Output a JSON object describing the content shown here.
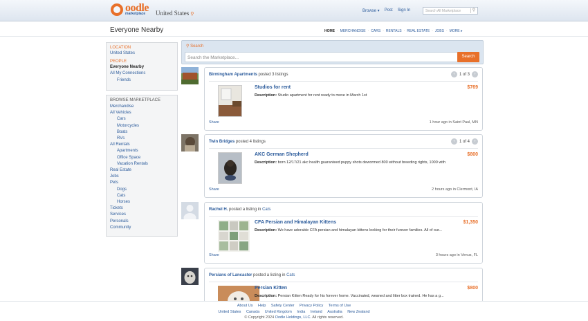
{
  "header": {
    "logo_main": "oodle",
    "logo_sub": "marketplace",
    "country": "United States",
    "nav": [
      "Browse ▾",
      "Post",
      "Sign In"
    ],
    "search_placeholder": "Search All Marketplace"
  },
  "page": {
    "title": "Everyone Nearby",
    "categories": [
      "HOME",
      "MERCHANDISE",
      "CARS",
      "RENTALS",
      "REAL ESTATE",
      "JOBS",
      "MORE ▸"
    ]
  },
  "sidebar": {
    "location_head": "LOCATION",
    "location": "United States",
    "people_head": "PEOPLE",
    "people": [
      {
        "label": "Everyone Nearby"
      },
      {
        "label": "All My Connections"
      },
      {
        "label": "Friends"
      }
    ],
    "browse_head": "BROWSE MARKETPLACE",
    "browse": [
      {
        "label": "Merchandise",
        "sub": false
      },
      {
        "label": "All Vehicles",
        "sub": false
      },
      {
        "label": "Cars",
        "sub": true
      },
      {
        "label": "Motorcycles",
        "sub": true
      },
      {
        "label": "Boats",
        "sub": true
      },
      {
        "label": "RVs",
        "sub": true
      },
      {
        "label": "All Rentals",
        "sub": false
      },
      {
        "label": "Apartments",
        "sub": true
      },
      {
        "label": "Office Space",
        "sub": true
      },
      {
        "label": "Vacation Rentals",
        "sub": true
      },
      {
        "label": "Real Estate",
        "sub": false
      },
      {
        "label": "Jobs",
        "sub": false
      },
      {
        "label": "Pets",
        "sub": false
      },
      {
        "label": "Dogs",
        "sub": true
      },
      {
        "label": "Cats",
        "sub": true
      },
      {
        "label": "Horses",
        "sub": true
      },
      {
        "label": "Tickets",
        "sub": false
      },
      {
        "label": "Services",
        "sub": false
      },
      {
        "label": "Personals",
        "sub": false
      },
      {
        "label": "Community",
        "sub": false
      }
    ]
  },
  "search": {
    "label": "Search",
    "placeholder": "Search the Marketplace...",
    "button": "Search"
  },
  "feed": [
    {
      "poster": "Birmingham Apartments",
      "action": "posted 3 listings",
      "pager": "1 of 3",
      "title": "Studios for rent",
      "price": "$769",
      "desc": "Studio apartment for rent ready to move in March 1st",
      "share": "Share",
      "meta": "1 hour ago in Saint Paul, MN"
    },
    {
      "poster": "Twin Bridges",
      "action": "posted 4 listings",
      "pager": "1 of 4",
      "title": "AKC German Shepherd",
      "price": "$800",
      "desc": "born 12/17/21 akc health guaranteed puppy shots dewormed 800 without breeding rights, 1000 with",
      "share": "Share",
      "meta": "2 hours ago in Clermont, IA"
    },
    {
      "poster": "Rachel H.",
      "action": "posted a listing in",
      "category": "Cats",
      "title": "CFA Persian and Himalayan Kittens",
      "price": "$1,350",
      "desc": "We have adorable CFA persian and himalayan kittens looking for their furever families. All of our...",
      "share": "Share",
      "meta": "3 hours ago in Venus, FL"
    },
    {
      "poster": "Persians of Lancaster",
      "action": "posted a listing in",
      "category": "Cats",
      "title": "Persian Kitten",
      "price": "$800",
      "desc": "Persian Kitten Ready for his forever home. Vaccinated, weaned and litter box trained. He has a g..."
    }
  ],
  "desc_label": "Description:",
  "footer": {
    "links1": [
      "About Us",
      "Help",
      "Safety Center",
      "Privacy Policy",
      "Terms of Use"
    ],
    "links2": [
      "United States",
      "Canada",
      "United Kingdom",
      "India",
      "Ireland",
      "Australia",
      "New Zealand"
    ],
    "copyright_prefix": "© Copyright 2024",
    "company": "Oodle Holdings, LLC.",
    "copyright_suffix": "All rights reserved."
  },
  "colors": {
    "accent": "#e8702a",
    "link": "#2b5b9b"
  }
}
